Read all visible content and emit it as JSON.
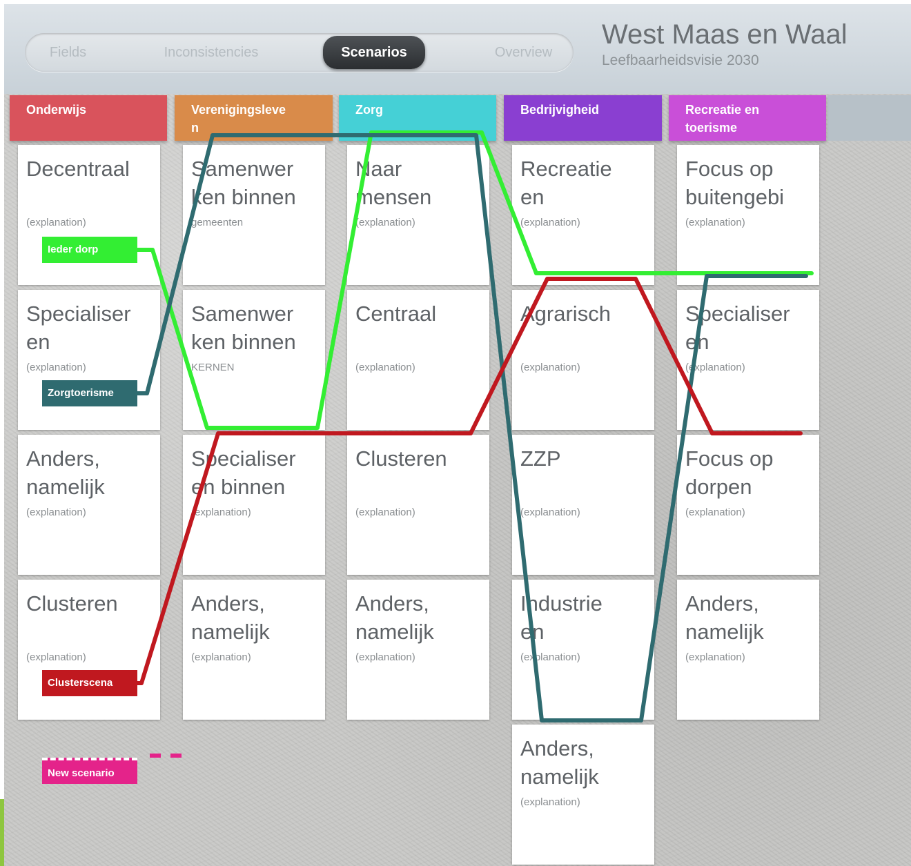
{
  "header": {
    "tabs": [
      {
        "label": "Fields",
        "active": false
      },
      {
        "label": "Inconsistencies",
        "active": false
      },
      {
        "label": "Scenarios",
        "active": true
      },
      {
        "label": "Overview",
        "active": false
      }
    ],
    "title": "West Maas en Waal",
    "subtitle": "Leefbaarheidsvisie 2030"
  },
  "columns": [
    {
      "name": "Onderwijs",
      "color": "#d9535c",
      "cards": [
        {
          "title": "Decentraal",
          "explanation": "(explanation)"
        },
        {
          "title": "Specialiser\nen",
          "explanation": "(explanation)"
        },
        {
          "title": "Anders,\nnamelijk",
          "explanation": "(explanation)"
        },
        {
          "title": "Clusteren",
          "explanation": "(explanation)"
        }
      ]
    },
    {
      "name": "Verenigingsleve\nn",
      "color": "#d98b4a",
      "cards": [
        {
          "title": "Samenwer\nken binnen",
          "explanation": "gemeenten"
        },
        {
          "title": "Samenwer\nken binnen",
          "explanation": "KERNEN"
        },
        {
          "title": "Specialiser\nen binnen",
          "explanation": "(explanation)"
        },
        {
          "title": "Anders,\nnamelijk",
          "explanation": "(explanation)"
        }
      ]
    },
    {
      "name": "Zorg",
      "color": "#45d0d6",
      "cards": [
        {
          "title": "Naar\nmensen",
          "explanation": "(explanation)"
        },
        {
          "title": "Centraal",
          "explanation": "(explanation)"
        },
        {
          "title": "Clusteren",
          "explanation": "(explanation)"
        },
        {
          "title": "Anders,\nnamelijk",
          "explanation": "(explanation)"
        }
      ]
    },
    {
      "name": "Bedrijvigheid",
      "color": "#8a3fd1",
      "cards": [
        {
          "title": "Recreatie\nen",
          "explanation": "(explanation)"
        },
        {
          "title": "Agrarisch",
          "explanation": "(explanation)"
        },
        {
          "title": "ZZP",
          "explanation": "(explanation)"
        },
        {
          "title": "Industrie\nen",
          "explanation": "(explanation)"
        },
        {
          "title": "Anders,\nnamelijk",
          "explanation": "(explanation)"
        }
      ]
    },
    {
      "name": "Recreatie en\ntoerisme",
      "color": "#c94fd8",
      "cards": [
        {
          "title": "Focus op\nbuitengebi",
          "explanation": "(explanation)"
        },
        {
          "title": "Specialiser\nen",
          "explanation": "(explanation)"
        },
        {
          "title": "Focus op\ndorpen",
          "explanation": "(explanation)"
        },
        {
          "title": "Anders,\nnamelijk",
          "explanation": "(explanation)"
        }
      ]
    }
  ],
  "scenarios": [
    {
      "label": "Ieder dorp",
      "color": "#33ee33",
      "path": [
        0,
        2,
        0,
        1,
        1
      ]
    },
    {
      "label": "Zorgtoerisme",
      "color": "#2f6b70",
      "path": [
        1,
        0,
        0,
        4,
        1
      ]
    },
    {
      "label": "Clusterscena",
      "color": "#c0181f",
      "path": [
        3,
        2,
        2,
        1,
        2
      ]
    }
  ],
  "new_scenario": {
    "label": "New scenario",
    "color": "#e4238a"
  }
}
